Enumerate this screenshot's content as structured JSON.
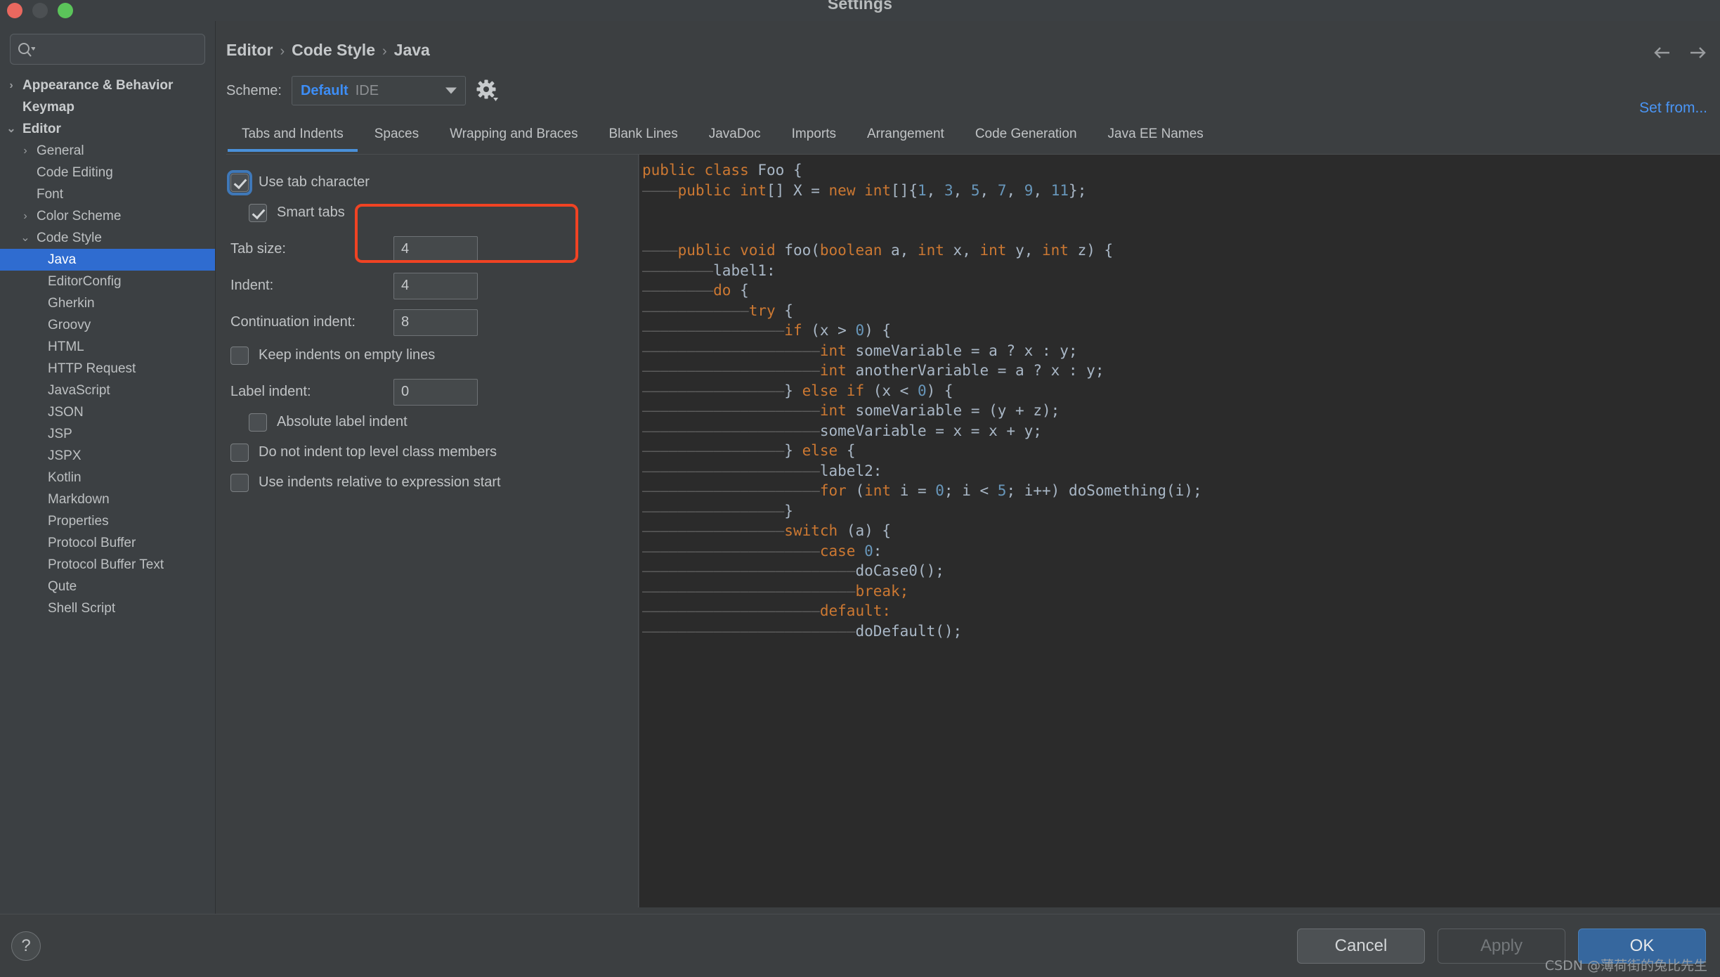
{
  "window": {
    "title": "Settings",
    "traffic_lights": [
      "close-red",
      "minimize-gray",
      "zoom-green"
    ]
  },
  "sidebar": {
    "search": {
      "value": "",
      "placeholder": "",
      "icon": "search-icon"
    },
    "items": [
      {
        "label": "Appearance & Behavior",
        "depth": 0,
        "arrow": "›",
        "bold": true,
        "selected": false
      },
      {
        "label": "Keymap",
        "depth": 0,
        "arrow": "",
        "bold": true,
        "selected": false
      },
      {
        "label": "Editor",
        "depth": 0,
        "arrow": "⌄",
        "bold": true,
        "selected": false
      },
      {
        "label": "General",
        "depth": 1,
        "arrow": "›",
        "bold": false,
        "selected": false
      },
      {
        "label": "Code Editing",
        "depth": 1,
        "arrow": "",
        "bold": false,
        "selected": false
      },
      {
        "label": "Font",
        "depth": 1,
        "arrow": "",
        "bold": false,
        "selected": false
      },
      {
        "label": "Color Scheme",
        "depth": 1,
        "arrow": "›",
        "bold": false,
        "selected": false
      },
      {
        "label": "Code Style",
        "depth": 1,
        "arrow": "⌄",
        "bold": false,
        "selected": false
      },
      {
        "label": "Java",
        "depth": 2,
        "arrow": "",
        "bold": false,
        "selected": true
      },
      {
        "label": "EditorConfig",
        "depth": 2,
        "arrow": "",
        "bold": false,
        "selected": false
      },
      {
        "label": "Gherkin",
        "depth": 2,
        "arrow": "",
        "bold": false,
        "selected": false
      },
      {
        "label": "Groovy",
        "depth": 2,
        "arrow": "",
        "bold": false,
        "selected": false
      },
      {
        "label": "HTML",
        "depth": 2,
        "arrow": "",
        "bold": false,
        "selected": false
      },
      {
        "label": "HTTP Request",
        "depth": 2,
        "arrow": "",
        "bold": false,
        "selected": false
      },
      {
        "label": "JavaScript",
        "depth": 2,
        "arrow": "",
        "bold": false,
        "selected": false
      },
      {
        "label": "JSON",
        "depth": 2,
        "arrow": "",
        "bold": false,
        "selected": false
      },
      {
        "label": "JSP",
        "depth": 2,
        "arrow": "",
        "bold": false,
        "selected": false
      },
      {
        "label": "JSPX",
        "depth": 2,
        "arrow": "",
        "bold": false,
        "selected": false
      },
      {
        "label": "Kotlin",
        "depth": 2,
        "arrow": "",
        "bold": false,
        "selected": false
      },
      {
        "label": "Markdown",
        "depth": 2,
        "arrow": "",
        "bold": false,
        "selected": false
      },
      {
        "label": "Properties",
        "depth": 2,
        "arrow": "",
        "bold": false,
        "selected": false
      },
      {
        "label": "Protocol Buffer",
        "depth": 2,
        "arrow": "",
        "bold": false,
        "selected": false
      },
      {
        "label": "Protocol Buffer Text",
        "depth": 2,
        "arrow": "",
        "bold": false,
        "selected": false
      },
      {
        "label": "Qute",
        "depth": 2,
        "arrow": "",
        "bold": false,
        "selected": false
      },
      {
        "label": "Shell Script",
        "depth": 2,
        "arrow": "",
        "bold": false,
        "selected": false
      }
    ]
  },
  "header": {
    "breadcrumb": [
      "Editor",
      "Code Style",
      "Java"
    ],
    "breadcrumb_separator": "›",
    "back_icon": "arrow-left-icon",
    "forward_icon": "arrow-right-icon",
    "scheme_label": "Scheme:",
    "scheme_value": "Default",
    "scheme_scope": "IDE",
    "gear_icon": "gear-icon",
    "set_from_label": "Set from..."
  },
  "tabs": {
    "active_index": 0,
    "items": [
      "Tabs and Indents",
      "Spaces",
      "Wrapping and Braces",
      "Blank Lines",
      "JavaDoc",
      "Imports",
      "Arrangement",
      "Code Generation",
      "Java EE Names"
    ]
  },
  "options": {
    "use_tab_character": {
      "label": "Use tab character",
      "checked": true,
      "focused": true
    },
    "smart_tabs": {
      "label": "Smart tabs",
      "checked": true
    },
    "tab_size": {
      "label": "Tab size:",
      "value": "4"
    },
    "indent": {
      "label": "Indent:",
      "value": "4"
    },
    "continuation_indent": {
      "label": "Continuation indent:",
      "value": "8"
    },
    "keep_indents_on_empty_lines": {
      "label": "Keep indents on empty lines",
      "checked": false
    },
    "label_indent": {
      "label": "Label indent:",
      "value": "0"
    },
    "absolute_label_indent": {
      "label": "Absolute label indent",
      "checked": false
    },
    "do_not_indent_top_level": {
      "label": "Do not indent top level class members",
      "checked": false
    },
    "use_indents_relative": {
      "label": "Use indents relative to expression start",
      "checked": false
    },
    "highlight_color": "#f04323"
  },
  "preview": {
    "tab_mark": "————",
    "lines": [
      [
        {
          "t": "public class ",
          "c": "kw"
        },
        {
          "t": "Foo {",
          "c": ""
        }
      ],
      [
        {
          "t": "\t",
          "c": "tab"
        },
        {
          "t": "public int",
          "c": "kw"
        },
        {
          "t": "[] X = ",
          "c": ""
        },
        {
          "t": "new int",
          "c": "kw"
        },
        {
          "t": "[]{",
          "c": ""
        },
        {
          "t": "1",
          "c": "num"
        },
        {
          "t": ", ",
          "c": ""
        },
        {
          "t": "3",
          "c": "num"
        },
        {
          "t": ", ",
          "c": ""
        },
        {
          "t": "5",
          "c": "num"
        },
        {
          "t": ", ",
          "c": ""
        },
        {
          "t": "7",
          "c": "num"
        },
        {
          "t": ", ",
          "c": ""
        },
        {
          "t": "9",
          "c": "num"
        },
        {
          "t": ", ",
          "c": ""
        },
        {
          "t": "11",
          "c": "num"
        },
        {
          "t": "};",
          "c": ""
        }
      ],
      [],
      [],
      [
        {
          "t": "\t",
          "c": "tab"
        },
        {
          "t": "public void ",
          "c": "kw"
        },
        {
          "t": "foo(",
          "c": ""
        },
        {
          "t": "boolean ",
          "c": "kw"
        },
        {
          "t": "a, ",
          "c": ""
        },
        {
          "t": "int ",
          "c": "kw"
        },
        {
          "t": "x, ",
          "c": ""
        },
        {
          "t": "int ",
          "c": "kw"
        },
        {
          "t": "y, ",
          "c": ""
        },
        {
          "t": "int ",
          "c": "kw"
        },
        {
          "t": "z) {",
          "c": ""
        }
      ],
      [
        {
          "t": "\t\t",
          "c": "tab"
        },
        {
          "t": "label1:",
          "c": ""
        }
      ],
      [
        {
          "t": "\t\t",
          "c": "tab"
        },
        {
          "t": "do ",
          "c": "kw"
        },
        {
          "t": "{",
          "c": ""
        }
      ],
      [
        {
          "t": "\t\t\t",
          "c": "tab"
        },
        {
          "t": "try ",
          "c": "kw"
        },
        {
          "t": "{",
          "c": ""
        }
      ],
      [
        {
          "t": "\t\t\t\t",
          "c": "tab"
        },
        {
          "t": "if ",
          "c": "kw"
        },
        {
          "t": "(x > ",
          "c": ""
        },
        {
          "t": "0",
          "c": "num"
        },
        {
          "t": ") {",
          "c": ""
        }
      ],
      [
        {
          "t": "\t\t\t\t\t",
          "c": "tab"
        },
        {
          "t": "int ",
          "c": "kw"
        },
        {
          "t": "someVariable = a ? x : y;",
          "c": ""
        }
      ],
      [
        {
          "t": "\t\t\t\t\t",
          "c": "tab"
        },
        {
          "t": "int ",
          "c": "kw"
        },
        {
          "t": "anotherVariable = a ? x : y;",
          "c": ""
        }
      ],
      [
        {
          "t": "\t\t\t\t",
          "c": "tab"
        },
        {
          "t": "} ",
          "c": ""
        },
        {
          "t": "else if ",
          "c": "kw"
        },
        {
          "t": "(x < ",
          "c": ""
        },
        {
          "t": "0",
          "c": "num"
        },
        {
          "t": ") {",
          "c": ""
        }
      ],
      [
        {
          "t": "\t\t\t\t\t",
          "c": "tab"
        },
        {
          "t": "int ",
          "c": "kw"
        },
        {
          "t": "someVariable = (y + z);",
          "c": ""
        }
      ],
      [
        {
          "t": "\t\t\t\t\t",
          "c": "tab"
        },
        {
          "t": "someVariable = x = x + y;",
          "c": ""
        }
      ],
      [
        {
          "t": "\t\t\t\t",
          "c": "tab"
        },
        {
          "t": "} ",
          "c": ""
        },
        {
          "t": "else ",
          "c": "kw"
        },
        {
          "t": "{",
          "c": ""
        }
      ],
      [
        {
          "t": "\t\t\t\t\t",
          "c": "tab"
        },
        {
          "t": "label2:",
          "c": ""
        }
      ],
      [
        {
          "t": "\t\t\t\t\t",
          "c": "tab"
        },
        {
          "t": "for ",
          "c": "kw"
        },
        {
          "t": "(",
          "c": ""
        },
        {
          "t": "int ",
          "c": "kw"
        },
        {
          "t": "i = ",
          "c": ""
        },
        {
          "t": "0",
          "c": "num"
        },
        {
          "t": "; i < ",
          "c": ""
        },
        {
          "t": "5",
          "c": "num"
        },
        {
          "t": "; i++) doSomething(i);",
          "c": ""
        }
      ],
      [
        {
          "t": "\t\t\t\t",
          "c": "tab"
        },
        {
          "t": "}",
          "c": ""
        }
      ],
      [
        {
          "t": "\t\t\t\t",
          "c": "tab"
        },
        {
          "t": "switch ",
          "c": "kw"
        },
        {
          "t": "(a) {",
          "c": ""
        }
      ],
      [
        {
          "t": "\t\t\t\t\t",
          "c": "tab"
        },
        {
          "t": "case ",
          "c": "kw"
        },
        {
          "t": "0",
          "c": "num"
        },
        {
          "t": ":",
          "c": ""
        }
      ],
      [
        {
          "t": "\t\t\t\t\t\t",
          "c": "tab"
        },
        {
          "t": "doCase0();",
          "c": ""
        }
      ],
      [
        {
          "t": "\t\t\t\t\t\t",
          "c": "tab"
        },
        {
          "t": "break;",
          "c": "kw"
        }
      ],
      [
        {
          "t": "\t\t\t\t\t",
          "c": "tab"
        },
        {
          "t": "default:",
          "c": "kw"
        }
      ],
      [
        {
          "t": "\t\t\t\t\t\t",
          "c": "tab"
        },
        {
          "t": "doDefault();",
          "c": ""
        }
      ]
    ]
  },
  "footer": {
    "help_label": "?",
    "cancel_label": "Cancel",
    "apply_label": "Apply",
    "ok_label": "OK",
    "watermark": "CSDN @薄荷街的兔比先生"
  }
}
